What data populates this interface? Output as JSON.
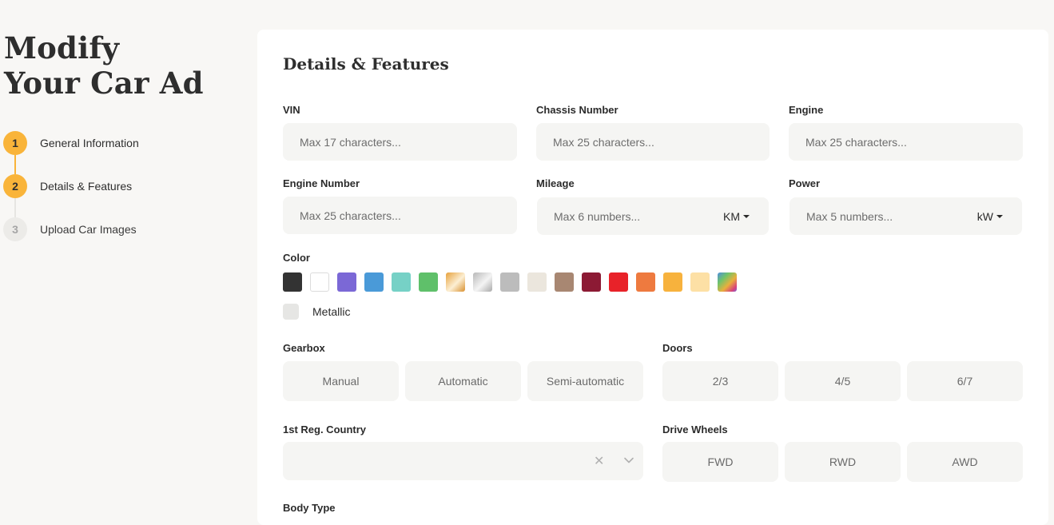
{
  "page": {
    "title_line1": "Modify",
    "title_line2": "Your Car Ad"
  },
  "steps": [
    {
      "num": "1",
      "label": "General Information"
    },
    {
      "num": "2",
      "label": "Details & Features"
    },
    {
      "num": "3",
      "label": "Upload Car Images"
    }
  ],
  "section": {
    "title": "Details & Features"
  },
  "fields": {
    "vin": {
      "label": "VIN",
      "placeholder": "Max 17 characters..."
    },
    "chassis": {
      "label": "Chassis Number",
      "placeholder": "Max 25 characters..."
    },
    "engine": {
      "label": "Engine",
      "placeholder": "Max 25 characters..."
    },
    "engine_number": {
      "label": "Engine Number",
      "placeholder": "Max 25 characters..."
    },
    "mileage": {
      "label": "Mileage",
      "placeholder": "Max 6 numbers...",
      "unit": "KM"
    },
    "power": {
      "label": "Power",
      "placeholder": "Max 5 numbers...",
      "unit": "kW"
    }
  },
  "color": {
    "label": "Color",
    "swatches": [
      "#333333",
      "#ffffff",
      "#7b68d6",
      "#4a9ad8",
      "#76d1c6",
      "#5fc06a",
      "gold-gradient",
      "silver-gradient",
      "#bcbcbc",
      "#ebe6dd",
      "#a88772",
      "#8c1a34",
      "#e82229",
      "#ee7a3f",
      "#f7b23d",
      "#fde0a5",
      "multicolor-gradient"
    ],
    "metallic_label": "Metallic"
  },
  "gearbox": {
    "label": "Gearbox",
    "options": [
      "Manual",
      "Automatic",
      "Semi-automatic"
    ]
  },
  "doors": {
    "label": "Doors",
    "options": [
      "2/3",
      "4/5",
      "6/7"
    ]
  },
  "reg_country": {
    "label": "1st Reg. Country",
    "clear_icon": "close-icon",
    "chevron_icon": "chevron-down-icon"
  },
  "drive_wheels": {
    "label": "Drive Wheels",
    "options": [
      "FWD",
      "RWD",
      "AWD"
    ]
  },
  "body_type": {
    "label": "Body Type"
  },
  "colors": {
    "accent": "#f9b43a",
    "field_bg": "#f5f5f3",
    "page_bg": "#f8f7f5"
  }
}
